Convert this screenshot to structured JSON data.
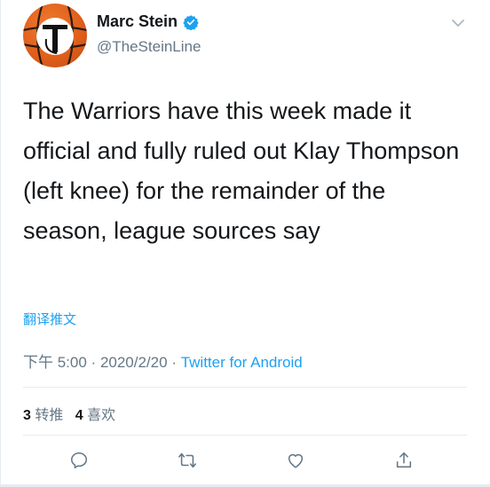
{
  "author": {
    "name": "Marc Stein",
    "handle": "@TheSteinLine"
  },
  "tweet": {
    "text": "The Warriors have this week made it official and fully ruled out Klay Thompson (left knee) for the remainder of the season, league sources say",
    "translate_label": "翻译推文",
    "time": "下午 5:00",
    "date": "2020/2/20",
    "source": "Twitter for Android"
  },
  "stats": {
    "retweets_count": "3",
    "retweets_label": "转推",
    "likes_count": "4",
    "likes_label": "喜欢"
  },
  "icons": {
    "reply": "reply-icon",
    "retweet": "retweet-icon",
    "like": "like-icon",
    "share": "share-icon",
    "verified": "verified-badge-icon",
    "more": "chevron-down-icon"
  },
  "colors": {
    "accent": "#1da1f2",
    "text": "#14171a",
    "secondary": "#657786",
    "avatar": "#e0601c"
  }
}
